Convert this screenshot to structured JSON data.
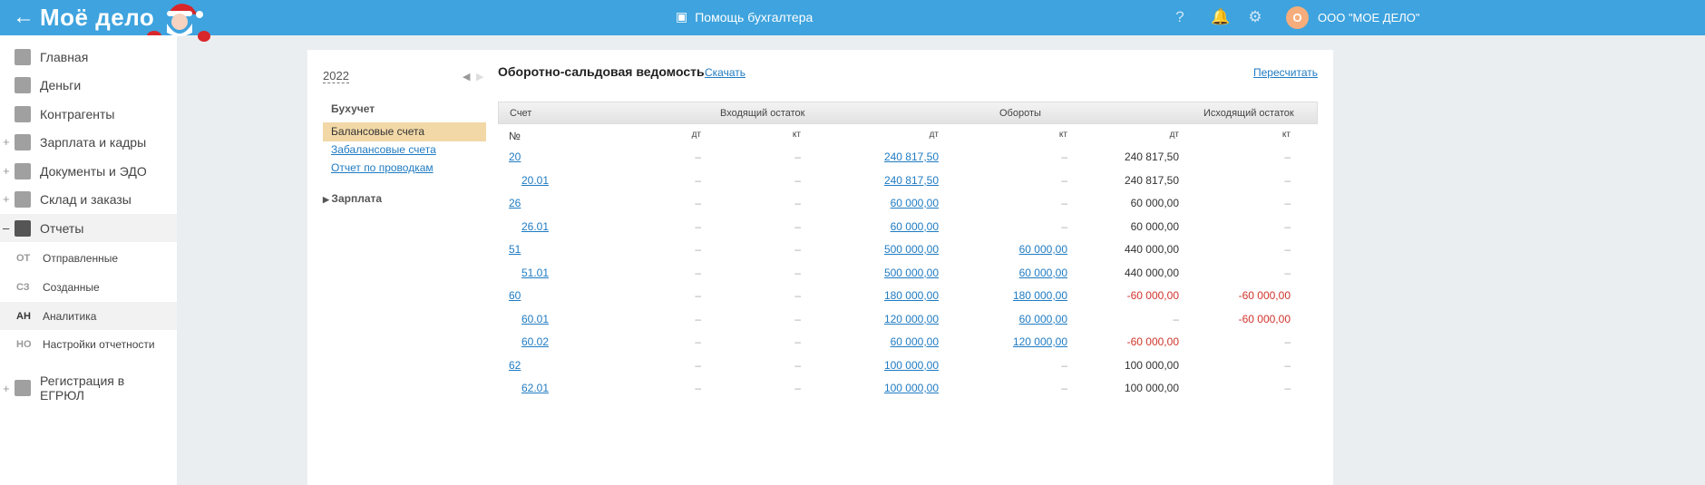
{
  "header": {
    "logo": "Моё дело",
    "helper": "Помощь бухгалтера",
    "org": "ООО \"МОЕ ДЕЛО\"",
    "avatar": "О"
  },
  "sidebar": {
    "items": [
      {
        "label": "Главная",
        "plus": false
      },
      {
        "label": "Деньги",
        "plus": false
      },
      {
        "label": "Контрагенты",
        "plus": false
      },
      {
        "label": "Зарплата и кадры",
        "plus": true
      },
      {
        "label": "Документы и ЭДО",
        "plus": true
      },
      {
        "label": "Склад и заказы",
        "plus": true
      },
      {
        "label": "Отчеты",
        "plus": false,
        "minus": true
      }
    ],
    "sub": [
      {
        "abbr": "ОТ",
        "label": "Отправленные"
      },
      {
        "abbr": "СЗ",
        "label": "Созданные"
      },
      {
        "abbr": "АН",
        "label": "Аналитика"
      },
      {
        "abbr": "НО",
        "label": "Настройки отчетности"
      }
    ],
    "registration": [
      "Регистрация в",
      "ЕГРЮЛ"
    ]
  },
  "left": {
    "year": "2022",
    "section": "Бухучет",
    "items": [
      "Балансовые счета",
      "Забалансовые счета",
      "Отчет по проводкам"
    ],
    "salary": "Зарплата"
  },
  "report": {
    "title": "Оборотно-сальдовая ведомость",
    "download": "Скачать",
    "recalc": "Пересчитать",
    "head": {
      "account": "Счет",
      "opening": "Входящий остаток",
      "turnover": "Обороты",
      "closing": "Исходящий остаток",
      "no": "№",
      "dt": "дт",
      "kt": "кт"
    },
    "rows": [
      [
        "20",
        "–",
        "–",
        "240 817,50",
        "–",
        "240 817,50",
        "–"
      ],
      [
        "20.01",
        "–",
        "–",
        "240 817,50",
        "–",
        "240 817,50",
        "–"
      ],
      [
        "26",
        "–",
        "–",
        "60 000,00",
        "–",
        "60 000,00",
        "–"
      ],
      [
        "26.01",
        "–",
        "–",
        "60 000,00",
        "–",
        "60 000,00",
        "–"
      ],
      [
        "51",
        "–",
        "–",
        "500 000,00",
        "60 000,00",
        "440 000,00",
        "–"
      ],
      [
        "51.01",
        "–",
        "–",
        "500 000,00",
        "60 000,00",
        "440 000,00",
        "–"
      ],
      [
        "60",
        "–",
        "–",
        "180 000,00",
        "180 000,00",
        "-60 000,00",
        "-60 000,00"
      ],
      [
        "60.01",
        "–",
        "–",
        "120 000,00",
        "60 000,00",
        "–",
        "-60 000,00"
      ],
      [
        "60.02",
        "–",
        "–",
        "60 000,00",
        "120 000,00",
        "-60 000,00",
        "–"
      ],
      [
        "62",
        "–",
        "–",
        "100 000,00",
        "–",
        "100 000,00",
        "–"
      ],
      [
        "62.01",
        "–",
        "–",
        "100 000,00",
        "–",
        "100 000,00",
        "–"
      ]
    ]
  }
}
